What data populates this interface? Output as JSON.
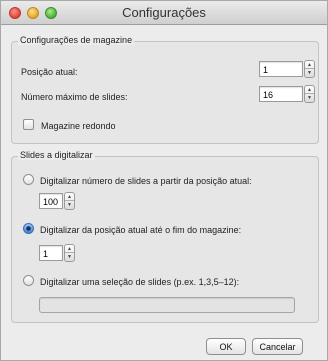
{
  "window": {
    "title": "Configurações",
    "controls": {
      "close": "close-icon",
      "minimize": "minimize-icon",
      "zoom": "zoom-icon"
    }
  },
  "magazine": {
    "group_title": "Configurações de magazine",
    "position_label": "Posição atual:",
    "position_value": "1",
    "max_slides_label": "Número máximo de slides:",
    "max_slides_value": "16",
    "round_magazine_label": "Magazine redondo",
    "round_magazine_checked": false
  },
  "digitize": {
    "group_title": "Slides a digitalizar",
    "option1_label": "Digitalizar número de slides a partir da posição atual:",
    "option1_value": "100",
    "option1_selected": false,
    "option2_label": "Digitalizar da posição atual até o fim do magazine:",
    "option2_value": "1",
    "option2_selected": true,
    "option3_label": "Digitalizar uma seleção de slides (p.ex. 1,3,5–12):",
    "option3_value": "",
    "option3_selected": false
  },
  "buttons": {
    "ok": "OK",
    "cancel": "Cancelar"
  },
  "icons": {
    "stepper_up": "▲",
    "stepper_down": "▼"
  },
  "colors": {
    "accent": "#3b82d6",
    "window_bg": "#ececec"
  }
}
